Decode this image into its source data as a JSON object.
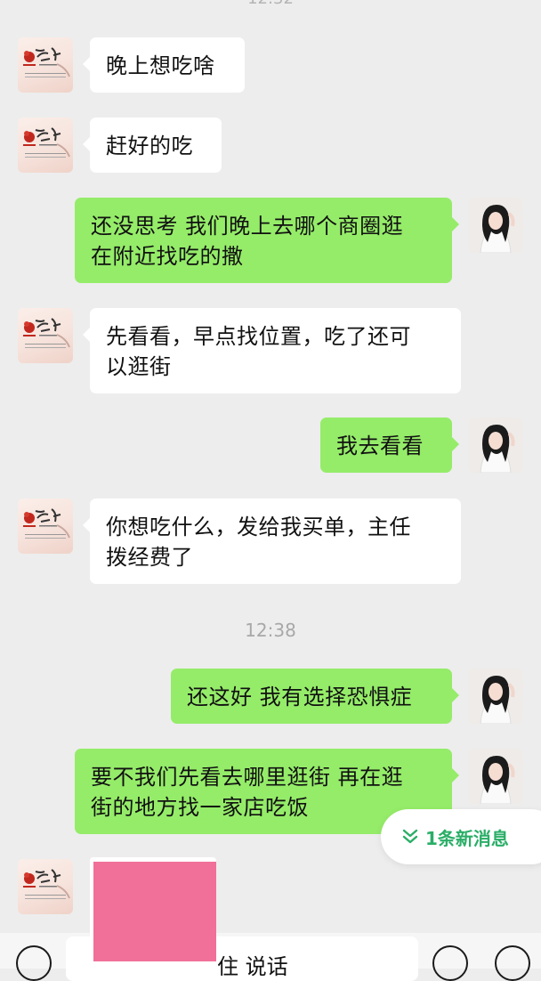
{
  "chat": {
    "top_time_partial": "12:32",
    "timestamp": "12:38",
    "messages": [
      {
        "side": "left",
        "text": "晚上想吃啥"
      },
      {
        "side": "left",
        "text": "赶好的吃"
      },
      {
        "side": "right",
        "line1": "还没思考 我们晚上去哪个商圈逛",
        "line2": "在附近找吃的撒"
      },
      {
        "side": "left",
        "line1": "先看看，早点找位置，吃了还可",
        "line2": "以逛街"
      },
      {
        "side": "right",
        "text": "我去看看"
      },
      {
        "side": "left",
        "line1": "你想吃什么，发给我买单，主任",
        "line2": "拨经费了"
      },
      {
        "side": "right",
        "text": "还这好 我有选择恐惧症"
      },
      {
        "side": "right",
        "line1": "要不我们先看去哪里逛街 再在逛",
        "line2": "街的地方找一家店吃饭"
      }
    ],
    "new_messages_label": "1条新消息"
  },
  "input": {
    "partial_text": "住 说话"
  },
  "colors": {
    "background": "#ededed",
    "sent_bubble": "#95ec69",
    "received_bubble": "#ffffff",
    "accent_green": "#2aae67",
    "image_pink": "#f07099"
  },
  "icons": {
    "voice": "voice-icon",
    "emoji": "emoji-icon",
    "plus": "plus-icon",
    "new_messages": "double-chevron-down-icon"
  }
}
